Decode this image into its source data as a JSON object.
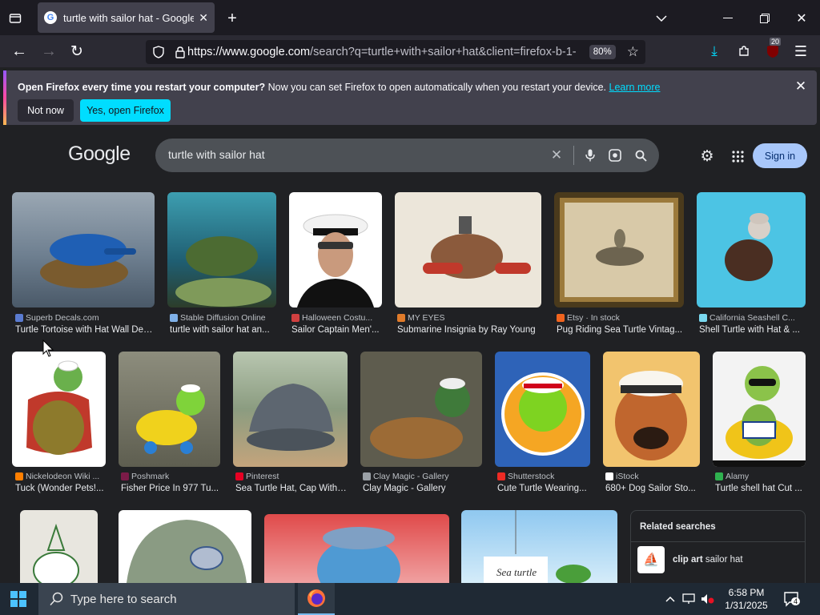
{
  "browser": {
    "tab_title": "turtle with sailor hat - Google Sear",
    "url_host": "https://www.google.com",
    "url_path": "/search?q=turtle+with+sailor+hat&client=firefox-b-1-",
    "zoom": "80%",
    "extension_badge": "20"
  },
  "notification": {
    "bold": "Open Firefox every time you restart your computer?",
    "text": " Now you can set Firefox to open automatically when you restart your device. ",
    "link": "Learn more",
    "not_now": "Not now",
    "yes": "Yes, open Firefox"
  },
  "google": {
    "logo": "Google",
    "query": "turtle with sailor hat",
    "sign_in": "Sign in"
  },
  "results": [
    {
      "source": "Superb Decals.com",
      "caption": "Turtle Tortoise with Hat Wall Decal",
      "color": "#4a6fa5"
    },
    {
      "source": "Stable Diffusion Online",
      "caption": "turtle with sailor hat an...",
      "color": "#2e7d8c"
    },
    {
      "source": "Halloween Costu...",
      "caption": "Sailor Captain Men'...",
      "color": "#dddddd"
    },
    {
      "source": "MY EYES",
      "caption": "Submarine Insignia by Ray Young",
      "color": "#e8e2d6"
    },
    {
      "source": "Etsy · In stock",
      "caption": "Pug Riding Sea Turtle Vintag...",
      "color": "#6b5633"
    },
    {
      "source": "California Seashell C...",
      "caption": "Shell Turtle with Hat & ...",
      "color": "#4fc3e0"
    },
    {
      "source": "Nickelodeon Wiki ...",
      "caption": "Tuck (Wonder Pets!...",
      "color": "#f5f5f5"
    },
    {
      "source": "Poshmark",
      "caption": "Fisher Price In 977 Tu...",
      "color": "#8c8c7a"
    },
    {
      "source": "Pinterest",
      "caption": "Sea Turtle Hat, Cap With ...",
      "color": "#8a9aa0"
    },
    {
      "source": "Clay Magic - Gallery",
      "caption": "Clay Magic - Gallery",
      "color": "#6a6a5c"
    },
    {
      "source": "Shutterstock",
      "caption": "Cute Turtle Wearing...",
      "color": "#2e63b8"
    },
    {
      "source": "iStock",
      "caption": "680+ Dog Sailor Sto...",
      "color": "#f0c070"
    },
    {
      "source": "Alamy",
      "caption": "Turtle shell hat Cut ...",
      "color": "#f3f3f3"
    }
  ],
  "related": {
    "heading": "Related searches",
    "item_bold": "clip art",
    "item_text": " sailor hat"
  },
  "taskbar": {
    "search_placeholder": "Type here to search",
    "time": "6:58 PM",
    "date": "1/31/2025",
    "notif_count": "4"
  }
}
